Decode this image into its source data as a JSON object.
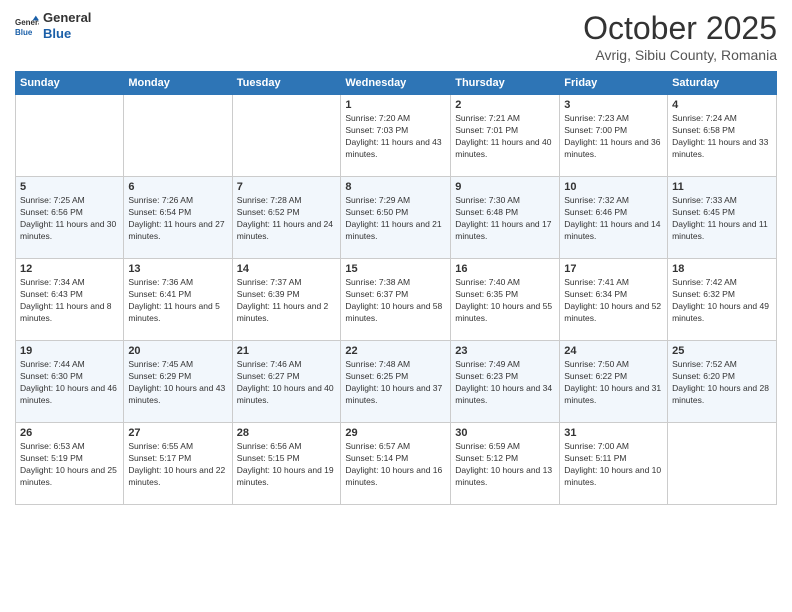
{
  "logo": {
    "general": "General",
    "blue": "Blue"
  },
  "header": {
    "title": "October 2025",
    "subtitle": "Avrig, Sibiu County, Romania"
  },
  "days_of_week": [
    "Sunday",
    "Monday",
    "Tuesday",
    "Wednesday",
    "Thursday",
    "Friday",
    "Saturday"
  ],
  "weeks": [
    [
      {
        "day": "",
        "info": ""
      },
      {
        "day": "",
        "info": ""
      },
      {
        "day": "",
        "info": ""
      },
      {
        "day": "1",
        "info": "Sunrise: 7:20 AM\nSunset: 7:03 PM\nDaylight: 11 hours and 43 minutes."
      },
      {
        "day": "2",
        "info": "Sunrise: 7:21 AM\nSunset: 7:01 PM\nDaylight: 11 hours and 40 minutes."
      },
      {
        "day": "3",
        "info": "Sunrise: 7:23 AM\nSunset: 7:00 PM\nDaylight: 11 hours and 36 minutes."
      },
      {
        "day": "4",
        "info": "Sunrise: 7:24 AM\nSunset: 6:58 PM\nDaylight: 11 hours and 33 minutes."
      }
    ],
    [
      {
        "day": "5",
        "info": "Sunrise: 7:25 AM\nSunset: 6:56 PM\nDaylight: 11 hours and 30 minutes."
      },
      {
        "day": "6",
        "info": "Sunrise: 7:26 AM\nSunset: 6:54 PM\nDaylight: 11 hours and 27 minutes."
      },
      {
        "day": "7",
        "info": "Sunrise: 7:28 AM\nSunset: 6:52 PM\nDaylight: 11 hours and 24 minutes."
      },
      {
        "day": "8",
        "info": "Sunrise: 7:29 AM\nSunset: 6:50 PM\nDaylight: 11 hours and 21 minutes."
      },
      {
        "day": "9",
        "info": "Sunrise: 7:30 AM\nSunset: 6:48 PM\nDaylight: 11 hours and 17 minutes."
      },
      {
        "day": "10",
        "info": "Sunrise: 7:32 AM\nSunset: 6:46 PM\nDaylight: 11 hours and 14 minutes."
      },
      {
        "day": "11",
        "info": "Sunrise: 7:33 AM\nSunset: 6:45 PM\nDaylight: 11 hours and 11 minutes."
      }
    ],
    [
      {
        "day": "12",
        "info": "Sunrise: 7:34 AM\nSunset: 6:43 PM\nDaylight: 11 hours and 8 minutes."
      },
      {
        "day": "13",
        "info": "Sunrise: 7:36 AM\nSunset: 6:41 PM\nDaylight: 11 hours and 5 minutes."
      },
      {
        "day": "14",
        "info": "Sunrise: 7:37 AM\nSunset: 6:39 PM\nDaylight: 11 hours and 2 minutes."
      },
      {
        "day": "15",
        "info": "Sunrise: 7:38 AM\nSunset: 6:37 PM\nDaylight: 10 hours and 58 minutes."
      },
      {
        "day": "16",
        "info": "Sunrise: 7:40 AM\nSunset: 6:35 PM\nDaylight: 10 hours and 55 minutes."
      },
      {
        "day": "17",
        "info": "Sunrise: 7:41 AM\nSunset: 6:34 PM\nDaylight: 10 hours and 52 minutes."
      },
      {
        "day": "18",
        "info": "Sunrise: 7:42 AM\nSunset: 6:32 PM\nDaylight: 10 hours and 49 minutes."
      }
    ],
    [
      {
        "day": "19",
        "info": "Sunrise: 7:44 AM\nSunset: 6:30 PM\nDaylight: 10 hours and 46 minutes."
      },
      {
        "day": "20",
        "info": "Sunrise: 7:45 AM\nSunset: 6:29 PM\nDaylight: 10 hours and 43 minutes."
      },
      {
        "day": "21",
        "info": "Sunrise: 7:46 AM\nSunset: 6:27 PM\nDaylight: 10 hours and 40 minutes."
      },
      {
        "day": "22",
        "info": "Sunrise: 7:48 AM\nSunset: 6:25 PM\nDaylight: 10 hours and 37 minutes."
      },
      {
        "day": "23",
        "info": "Sunrise: 7:49 AM\nSunset: 6:23 PM\nDaylight: 10 hours and 34 minutes."
      },
      {
        "day": "24",
        "info": "Sunrise: 7:50 AM\nSunset: 6:22 PM\nDaylight: 10 hours and 31 minutes."
      },
      {
        "day": "25",
        "info": "Sunrise: 7:52 AM\nSunset: 6:20 PM\nDaylight: 10 hours and 28 minutes."
      }
    ],
    [
      {
        "day": "26",
        "info": "Sunrise: 6:53 AM\nSunset: 5:19 PM\nDaylight: 10 hours and 25 minutes."
      },
      {
        "day": "27",
        "info": "Sunrise: 6:55 AM\nSunset: 5:17 PM\nDaylight: 10 hours and 22 minutes."
      },
      {
        "day": "28",
        "info": "Sunrise: 6:56 AM\nSunset: 5:15 PM\nDaylight: 10 hours and 19 minutes."
      },
      {
        "day": "29",
        "info": "Sunrise: 6:57 AM\nSunset: 5:14 PM\nDaylight: 10 hours and 16 minutes."
      },
      {
        "day": "30",
        "info": "Sunrise: 6:59 AM\nSunset: 5:12 PM\nDaylight: 10 hours and 13 minutes."
      },
      {
        "day": "31",
        "info": "Sunrise: 7:00 AM\nSunset: 5:11 PM\nDaylight: 10 hours and 10 minutes."
      },
      {
        "day": "",
        "info": ""
      }
    ]
  ]
}
